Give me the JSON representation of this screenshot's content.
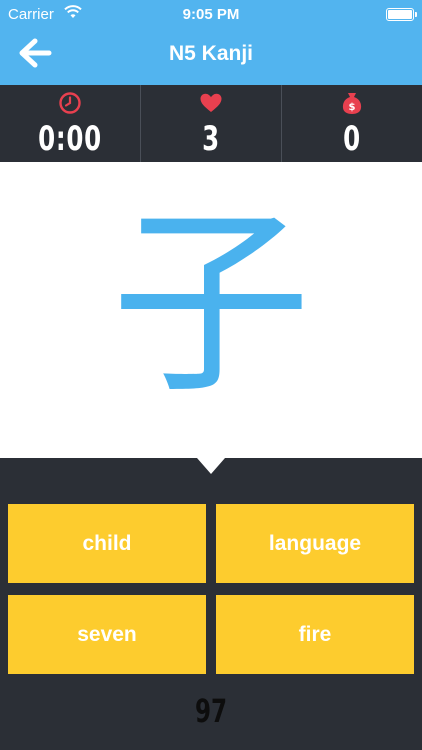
{
  "status_bar": {
    "carrier": "Carrier",
    "time": "9:05 PM"
  },
  "nav": {
    "title": "N5 Kanji",
    "back_icon": "arrow-left-icon"
  },
  "stats": {
    "timer": {
      "icon": "clock-icon",
      "value": "0:00"
    },
    "lives": {
      "icon": "heart-icon",
      "value": "3"
    },
    "coins": {
      "icon": "money-bag-icon",
      "value": "0"
    }
  },
  "question": {
    "kanji": "子"
  },
  "answers": [
    "child",
    "language",
    "seven",
    "fire"
  ],
  "remaining": "97",
  "colors": {
    "nav_blue": "#52b4ef",
    "dark": "#2b2f36",
    "answer_yellow": "#fdcc2e",
    "kanji_blue": "#4ab2ee",
    "icon_red": "#e8404f"
  }
}
